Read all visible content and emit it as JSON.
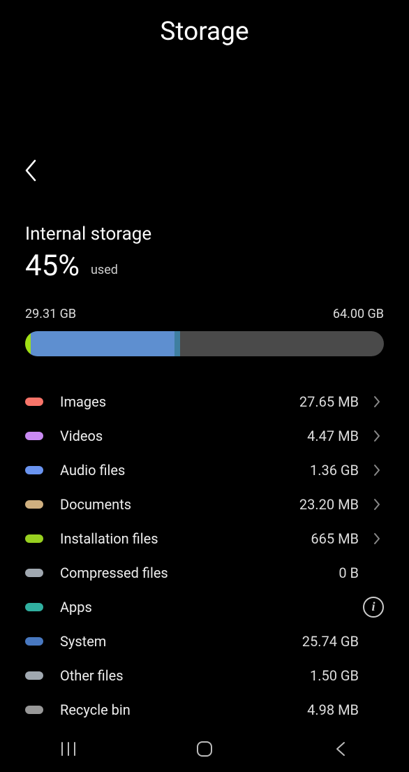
{
  "header": {
    "title": "Storage"
  },
  "storage": {
    "label": "Internal storage",
    "percent": "45%",
    "used_label": "used",
    "used_size": "29.31 GB",
    "total_size": "64.00 GB"
  },
  "categories": [
    {
      "label": "Images",
      "size": "27.65 MB",
      "color": "#f87469",
      "chevron": true,
      "info": false
    },
    {
      "label": "Videos",
      "size": "4.47 MB",
      "color": "#c98af2",
      "chevron": true,
      "info": false
    },
    {
      "label": "Audio files",
      "size": "1.36 GB",
      "color": "#6a94f0",
      "chevron": true,
      "info": false
    },
    {
      "label": "Documents",
      "size": "23.20 MB",
      "color": "#d0b080",
      "chevron": true,
      "info": false
    },
    {
      "label": "Installation files",
      "size": "665 MB",
      "color": "#98d020",
      "chevron": true,
      "info": false
    },
    {
      "label": "Compressed files",
      "size": "0 B",
      "color": "#a0a8b0",
      "chevron": false,
      "info": false
    },
    {
      "label": "Apps",
      "size": "",
      "color": "#30b0a0",
      "chevron": false,
      "info": true
    },
    {
      "label": "System",
      "size": "25.74 GB",
      "color": "#4878c0",
      "chevron": false,
      "info": false
    },
    {
      "label": "Other files",
      "size": "1.50 GB",
      "color": "#a0a8b0",
      "chevron": false,
      "info": false
    },
    {
      "label": "Recycle bin",
      "size": "4.98 MB",
      "color": "#989898",
      "chevron": false,
      "info": false
    }
  ]
}
